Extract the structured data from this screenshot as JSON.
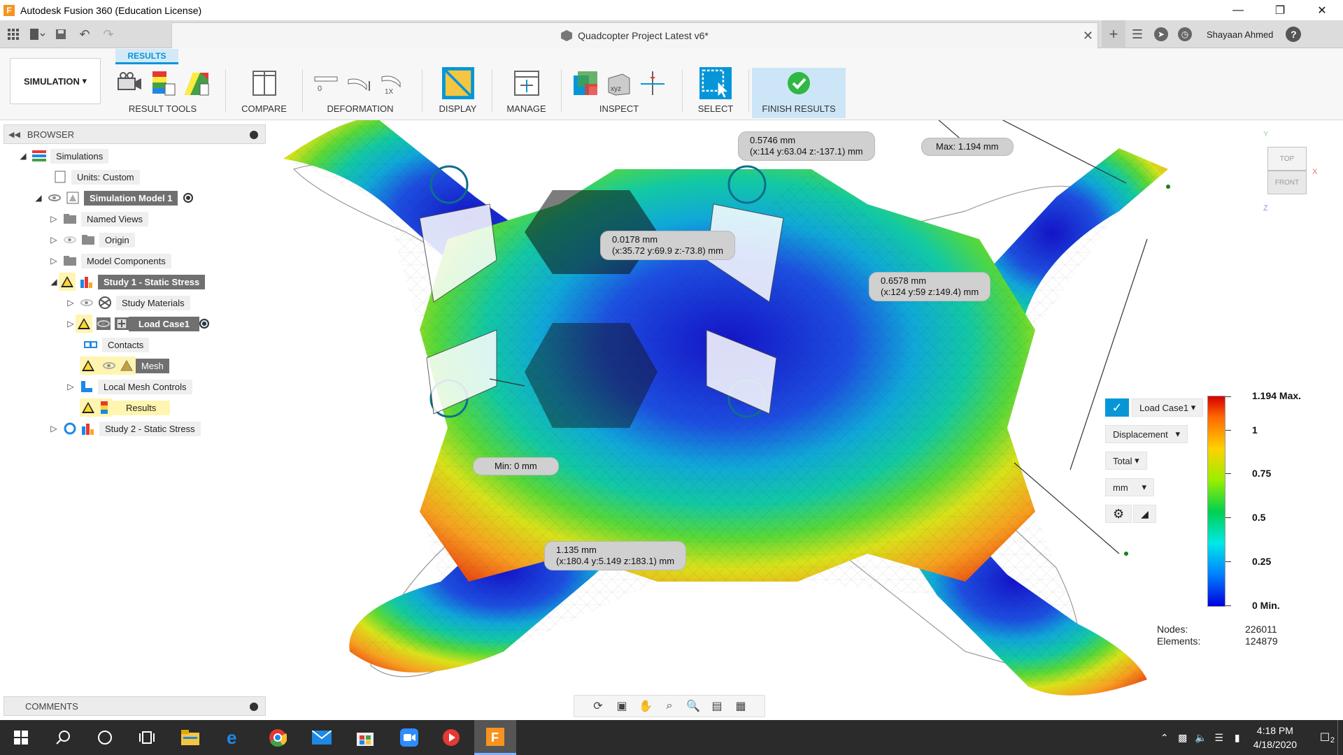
{
  "window": {
    "title": "Autodesk Fusion 360 (Education License)"
  },
  "document": {
    "title": "Quadcopter Project Latest v6*"
  },
  "user": {
    "name": "Shayaan Ahmed"
  },
  "toolbar": {
    "workspace": "SIMULATION",
    "active_tab": "RESULTS",
    "groups": [
      {
        "label": "RESULT TOOLS"
      },
      {
        "label": "COMPARE"
      },
      {
        "label": "DEFORMATION"
      },
      {
        "label": "DISPLAY"
      },
      {
        "label": "MANAGE"
      },
      {
        "label": "INSPECT"
      },
      {
        "label": "SELECT"
      },
      {
        "label": "FINISH RESULTS"
      }
    ]
  },
  "browser": {
    "title": "BROWSER",
    "items": [
      {
        "label": "Simulations"
      },
      {
        "label": "Units: Custom"
      },
      {
        "label": "Simulation Model 1"
      },
      {
        "label": "Named Views"
      },
      {
        "label": "Origin"
      },
      {
        "label": "Model Components"
      },
      {
        "label": "Study 1 - Static Stress"
      },
      {
        "label": "Study Materials"
      },
      {
        "label": "Load Case1"
      },
      {
        "label": "Contacts"
      },
      {
        "label": "Mesh"
      },
      {
        "label": "Local Mesh Controls"
      },
      {
        "label": "Results"
      },
      {
        "label": "Study 2 - Static Stress"
      }
    ],
    "comments": "COMMENTS"
  },
  "viewport": {
    "callouts": [
      {
        "line1": "0.5746 mm",
        "line2": "(x:114 y:63.04 z:-137.1) mm"
      },
      {
        "line1": "Max: 1.194 mm",
        "line2": ""
      },
      {
        "line1": "0.0178 mm",
        "line2": "(x:35.72 y:69.9 z:-73.8) mm"
      },
      {
        "line1": "0.6578 mm",
        "line2": "(x:124 y:59 z:149.4) mm"
      },
      {
        "line1": "Min: 0 mm",
        "line2": ""
      },
      {
        "line1": "1.135 mm",
        "line2": "(x:180.4 y:5.149 z:183.1) mm"
      }
    ],
    "viewcube": {
      "top": "TOP",
      "front": "FRONT",
      "axis_y": "Y",
      "axis_x": "X",
      "axis_z": "Z"
    }
  },
  "legend": {
    "load_case": "Load Case1",
    "result_type": "Displacement",
    "component": "Total",
    "unit": "mm",
    "ticks": [
      "1.194 Max.",
      "1",
      "0.75",
      "0.5",
      "0.25",
      "0 Min."
    ],
    "nodes_label": "Nodes:",
    "nodes_value": "226011",
    "elements_label": "Elements:",
    "elements_value": "124879"
  },
  "taskbar": {
    "time": "4:18 PM",
    "date": "4/18/2020",
    "notification_count": "2"
  },
  "colors": {
    "accent": "#0696d7",
    "taskbar": "#2b2b2b",
    "warning": "#ffd633"
  }
}
